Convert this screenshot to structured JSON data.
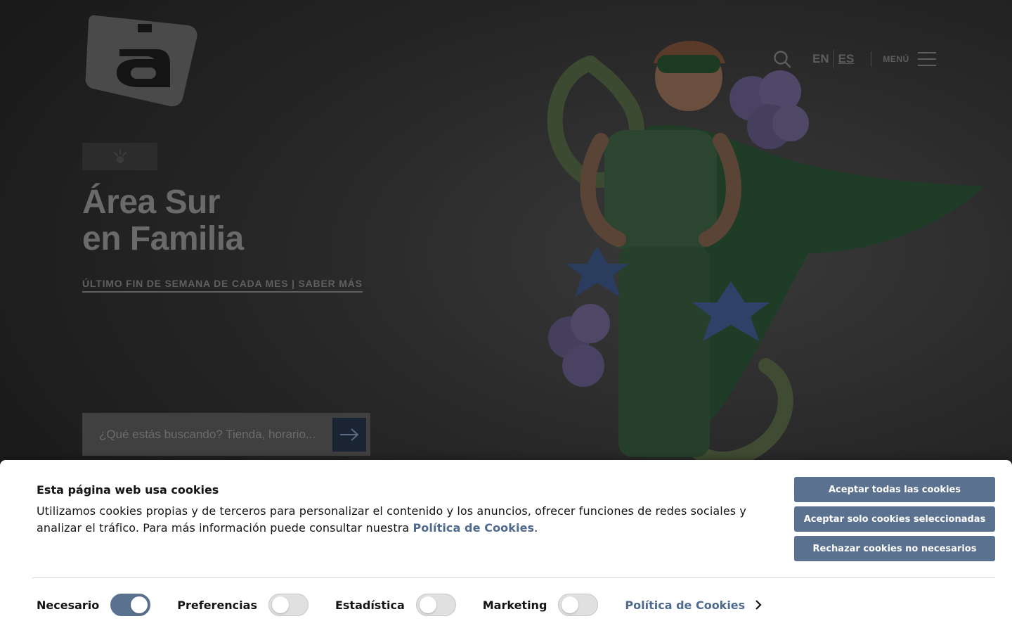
{
  "header": {
    "languages": [
      {
        "code": "EN",
        "active": false
      },
      {
        "code": "ES",
        "active": true
      }
    ],
    "menu_label": "MENÚ"
  },
  "hero": {
    "title_line1": "Área Sur",
    "title_line2": "en Familia",
    "link_text": "ÚLTIMO FIN DE SEMANA DE CADA MES | SABER MÁS"
  },
  "search": {
    "placeholder": "¿Qué estás buscando? Tienda, horario..."
  },
  "cookie_banner": {
    "title": "Esta página web usa cookies",
    "text_before_link": "Utilizamos cookies propias y de terceros para personalizar el contenido y los anuncios, ofrecer funciones de redes sociales y analizar el tráfico. Para más información puede consultar nuestra ",
    "text_link": "Política de Cookies",
    "text_after_link": ".",
    "buttons": {
      "accept_all": "Aceptar todas las cookies",
      "accept_selected": "Aceptar solo cookies seleccionadas",
      "reject": "Rechazar cookies no necesarios"
    },
    "options": [
      {
        "label": "Necesario",
        "enabled": true
      },
      {
        "label": "Preferencias",
        "enabled": false
      },
      {
        "label": "Estadística",
        "enabled": false
      },
      {
        "label": "Marketing",
        "enabled": false
      }
    ],
    "details_link": "Política de Cookies"
  },
  "colors": {
    "accent": "#5b7190",
    "link": "#4f6a8f"
  }
}
